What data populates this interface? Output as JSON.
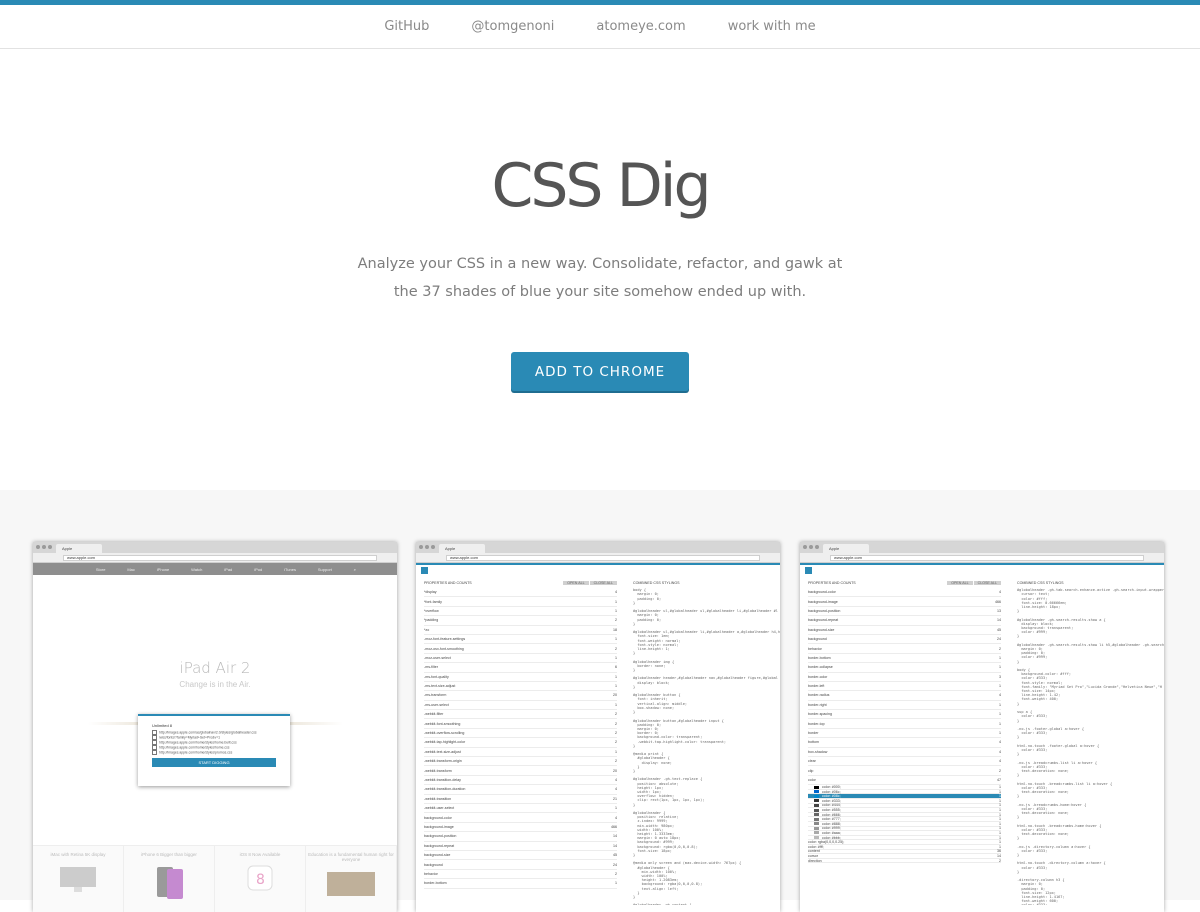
{
  "nav": {
    "items": [
      "GitHub",
      "@tomgenoni",
      "atomeye.com",
      "work with me"
    ]
  },
  "hero": {
    "title": "CSS Dig",
    "tagline": "Analyze your CSS in a new way. Consolidate, refactor, and gawk at the 37 shades of blue your site somehow ended up with.",
    "cta": "ADD TO CHROME"
  },
  "colors": {
    "accent": "#2a8ab5",
    "background": "#ffffff",
    "gallery_bg": "#f7f7f7"
  },
  "screens": {
    "one": {
      "tab": "Apple",
      "url": "www.apple.com",
      "apple_nav": [
        "",
        "Store",
        "Mac",
        "iPhone",
        "Watch",
        "iPad",
        "iPod",
        "iTunes",
        "Support",
        ""
      ],
      "title": "iPad Air 2",
      "subtitle": "Change is in the Air.",
      "popup_title": "Unlimited 8",
      "popup_links": [
        "http://images.apple.com/ac/globalnav/2.0/styles/globalheader.css",
        "/wss/fonts/?family=Myriad+Set+Pro&v=1",
        "http://images.apple.com/home/styles/home.built.css",
        "http://images.apple.com/home/styles/home.css",
        "http://images.apple.com/home/styles/promos.css"
      ],
      "popup_button": "START DIGGING",
      "bottom": [
        "iMac with Retina 5K display",
        "iPhone 6 Bigger than bigger",
        "iOS 8 Now Available",
        "Education is a fundamental human right for everyone"
      ]
    },
    "two": {
      "tab": "Apple",
      "url": "www.apple.com",
      "left_title": "PROPERTIES AND COUNTS",
      "right_title": "COMBINED CSS STYLINGS",
      "buttons": [
        "OPEN ALL",
        "CLOSE ALL"
      ],
      "rows": [
        [
          "*display",
          "4"
        ],
        [
          "*font-family",
          "1"
        ],
        [
          "*overflow",
          "1"
        ],
        [
          "*padding",
          "2"
        ],
        [
          "*zo",
          "18"
        ],
        [
          "-moz-font-feature-settings",
          "1"
        ],
        [
          "-moz-osx-font-smoothing",
          "2"
        ],
        [
          "-moz-user-select",
          "1"
        ],
        [
          "-ms-filter",
          "6"
        ],
        [
          "-ms-font-quality",
          "1"
        ],
        [
          "-ms-text-size-adjust",
          "1"
        ],
        [
          "-ms-transform",
          "20"
        ],
        [
          "-ms-user-select",
          "1"
        ],
        [
          "-webkit-filter",
          "2"
        ],
        [
          "-webkit-font-smoothing",
          "2"
        ],
        [
          "-webkit-overflow-scrolling",
          "2"
        ],
        [
          "-webkit-tap-highlight-color",
          "2"
        ],
        [
          "-webkit-text-size-adjust",
          "1"
        ],
        [
          "-webkit-transform-origin",
          "2"
        ],
        [
          "-webkit-transform",
          "20"
        ],
        [
          "-webkit-transition-delay",
          "4"
        ],
        [
          "-webkit-transition-duration",
          "4"
        ],
        [
          "-webkit-transition",
          "21"
        ],
        [
          "-webkit-user-select",
          "1"
        ],
        [
          "background-color",
          "4"
        ],
        [
          "background-image",
          "466"
        ],
        [
          "background-position",
          "14"
        ],
        [
          "background-repeat",
          "14"
        ],
        [
          "background-size",
          "45"
        ],
        [
          "background",
          "24"
        ],
        [
          "behavior",
          "2"
        ],
        [
          "border-bottom",
          "1"
        ]
      ],
      "code": "body {\n  margin: 0;\n  padding: 0;\n}\n\n#globalheader ul,#globalheader ul,#globalheader li,#globalheader #l\n  margin: 0;\n  padding: 0;\n}\n\n#globalheader ul,#globalheader li,#globalheader a,#globalheader h4,h\n  font-size: 1em;\n  font-weight: normal;\n  font-style: normal;\n  line-height: 1;\n}\n\n#globalheader img {\n  border: none;\n}\n\n#globalheader header,#globalheader nav,#globalheader figure,#global\n  display: block;\n}\n\n#globalheader button {\n  font: inherit;\n  vertical-align: middle;\n  box-shadow: none;\n}\n\n#globalheader button,#globalheader input {\n  padding: 0;\n  margin: 0;\n  border: 0;\n  background-color: transparent;\n  -webkit-tap-highlight-color: transparent;\n}\n\n@media print {\n  #globalheader {\n    display: none;\n  }\n}\n\n#globalheader .gh-text-replace {\n  position: absolute;\n  height: 1px;\n  width: 1px;\n  overflow: hidden;\n  clip: rect(1px, 1px, 1px, 1px);\n}\n\n#globalheader {\n  position: relative;\n  z-index: 9999;\n  min-width: 980px;\n  width: 100%;\n  height: 1.3333em;\n  margin: 0 auto 18px;\n  background: #999;\n  background: rgba(0,0,0,0.8);\n  font-size: 18px;\n}\n\n@media only screen and (max-device-width: 767px) {\n  #globalheader {\n    min-width: 100%;\n    width: 100%;\n    height: 1.2083em;\n    background: rgba(0,0,0,0.8);\n    text-align: left;\n  }\n}\n\n#globalheader .gh-content {\n  width: 980px;\n}"
    },
    "three": {
      "tab": "Apple",
      "url": "www.apple.com",
      "left_title": "PROPERTIES AND COUNTS",
      "right_title": "COMBINED CSS STYLINGS",
      "buttons": [
        "OPEN ALL",
        "CLOSE ALL"
      ],
      "rows": [
        [
          "background-color",
          "4"
        ],
        [
          "background-image",
          "466"
        ],
        [
          "background-position",
          "13"
        ],
        [
          "background-repeat",
          "14"
        ],
        [
          "background-size",
          "45"
        ],
        [
          "background",
          "24"
        ],
        [
          "behavior",
          "2"
        ],
        [
          "border-bottom",
          "1"
        ],
        [
          "border-collapse",
          "1"
        ],
        [
          "border-color",
          "3"
        ],
        [
          "border-left",
          "1"
        ],
        [
          "border-radius",
          "4"
        ],
        [
          "border-right",
          "1"
        ],
        [
          "border-spacing",
          "1"
        ],
        [
          "border-top",
          "1"
        ],
        [
          "border",
          "1"
        ],
        [
          "bottom",
          "4"
        ],
        [
          "box-shadow",
          "4"
        ],
        [
          "clear",
          "4"
        ],
        [
          "clip",
          "2"
        ],
        [
          "color",
          "47"
        ]
      ],
      "swatches": [
        [
          "#000",
          "color: #000;",
          "1"
        ],
        [
          "#06c",
          "color: #06c;",
          "1"
        ],
        [
          "#0088cc",
          "color: #08c;",
          "1"
        ],
        [
          "#333",
          "color: #333;",
          "1"
        ],
        [
          "#444",
          "color: #444;",
          "1"
        ],
        [
          "#555",
          "color: #555;",
          "1"
        ],
        [
          "#666",
          "color: #666;",
          "1"
        ],
        [
          "#777",
          "color: #777;",
          "1"
        ],
        [
          "#888",
          "color: #888;",
          "1"
        ],
        [
          "#999",
          "color: #999;",
          "1"
        ],
        [
          "#aaa",
          "color: #aaa;",
          "1"
        ],
        [
          "#bbb",
          "color: #bbb;",
          "1"
        ]
      ],
      "swatch_extra": [
        "color: rgba(0,0,0,0.25);",
        "color: #fff;"
      ],
      "rows_after": [
        [
          "content",
          "36"
        ],
        [
          "cursor",
          "14"
        ],
        [
          "direction",
          "2"
        ]
      ],
      "code": "#globalheader .gh-tab-search.enhance.active .gh-search-input-wrapper\n  cursor: text;\n  color: #fff;\n  font-size: 0.66666em;\n  line-height: 18px;\n}\n\n#globalheader .gh-search-results.show a {\n  display: block;\n  background: transparent;\n  color: #999;\n}\n\n#globalheader .gh-search-results.show li h5,#globalheader .gh-search\n  margin: 0;\n  padding: 0;\n  color: #999;\n}\n\nbody {\n  background-color: #fff;\n  color: #333;\n  font-style: normal;\n  font-family: \"Myriad Set Pro\",\"Lucida Grande\",\"Helvetica Neue\",\"H\n  font-size: 14px;\n  line-height: 1.42;\n  font-weight: 400;\n}\n\nsup a {\n  color: #333;\n}\n\n.no-js .footer-global a:hover {\n  color: #333;\n}\n\nhtml.no-touch .footer-global a:hover {\n  color: #333;\n}\n\n.no-js .breadcrumbs-list li a:hover {\n  color: #333;\n  text-decoration: none;\n}\n\nhtml.no-touch .breadcrumbs-list li a:hover {\n  color: #333;\n  text-decoration: none;\n}\n\n.no-js .breadcrumbs-home:hover {\n  color: #333;\n  text-decoration: none;\n}\n\nhtml.no-touch .breadcrumbs-home:hover {\n  color: #333;\n  text-decoration: none;\n}\n\n.no-js .directory-column a:hover {\n  color: #333;\n}\n\nhtml.no-touch .directory-column a:hover {\n  color: #333;\n}\n\n.directory-column h3 {\n  margin: 0;\n  padding: 0;\n  font-size: 12px;\n  line-height: 1.4167;\n  font-weight: 600;\n  color: #333;\n  letter-spacing: 0;\n}"
    }
  }
}
